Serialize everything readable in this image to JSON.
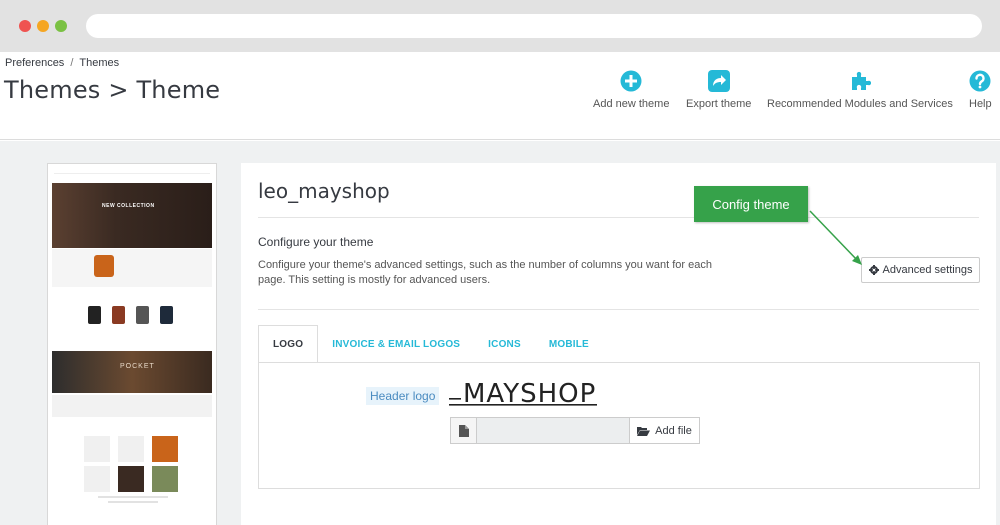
{
  "breadcrumb": {
    "item1": "Preferences",
    "separator": "/",
    "item2": "Themes"
  },
  "page_title": "Themes > Theme",
  "toolbar": {
    "add_new_theme": "Add new theme",
    "export_theme": "Export theme",
    "recommended": "Recommended Modules and Services",
    "help": "Help"
  },
  "colors": {
    "accent": "#25b9d7",
    "callout": "#36a24a",
    "background": "#eff1f2"
  },
  "preview": {
    "hero_text": "NEW COLLECTION",
    "banner_text": "POCKET"
  },
  "theme": {
    "name": "leo_mayshop",
    "configure_title": "Configure your theme",
    "configure_desc": "Configure your theme's advanced settings, such as the number of columns you want for each page. This setting is mostly for advanced users.",
    "advanced_settings": "Advanced settings"
  },
  "callout": {
    "text": "Config theme"
  },
  "tabs": [
    {
      "label": "LOGO",
      "active": true
    },
    {
      "label": "INVOICE & EMAIL LOGOS",
      "active": false
    },
    {
      "label": "ICONS",
      "active": false
    },
    {
      "label": "MOBILE",
      "active": false
    }
  ],
  "logo_tab": {
    "header_logo_label": "Header logo",
    "logo_text": "MAYSHOP",
    "add_file": "Add file"
  }
}
